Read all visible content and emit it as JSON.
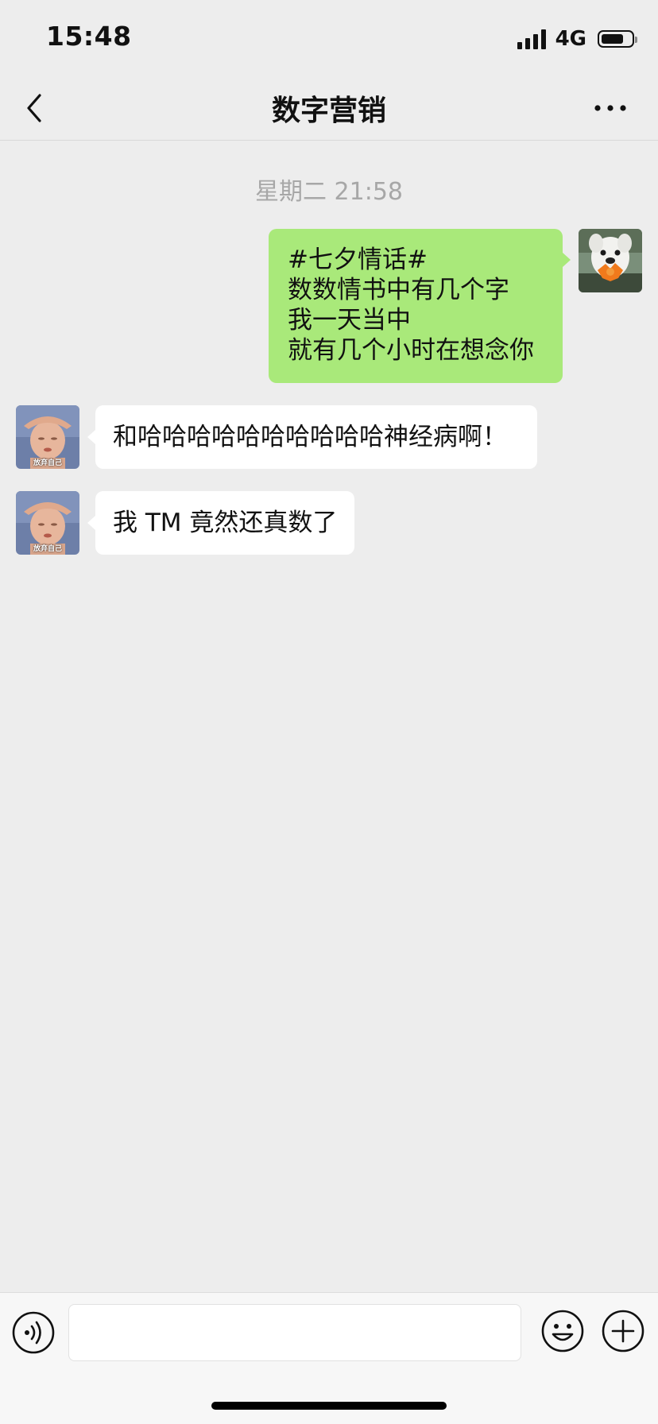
{
  "status_bar": {
    "time": "15:48",
    "network": "4G",
    "battery_level": 0.75
  },
  "nav": {
    "title": "数字营销",
    "back_icon": "chevron-left-icon",
    "more_icon": "more-dots-icon"
  },
  "chat": {
    "timestamp": "星期二 21:58",
    "messages": [
      {
        "direction": "sent",
        "lines": [
          "#七夕情话#",
          "数数情书中有几个字",
          "我一天当中",
          "就有几个小时在想念你"
        ]
      },
      {
        "direction": "received",
        "text": "和哈哈哈哈哈哈哈哈哈哈神经病啊！"
      },
      {
        "direction": "received",
        "text": "我 TM 竟然还真数了"
      }
    ],
    "sender_avatar_caption": "放弃自己"
  },
  "input_bar": {
    "message_value": "",
    "voice_icon": "voice-icon",
    "emoji_icon": "emoji-icon",
    "plus_icon": "plus-icon"
  }
}
